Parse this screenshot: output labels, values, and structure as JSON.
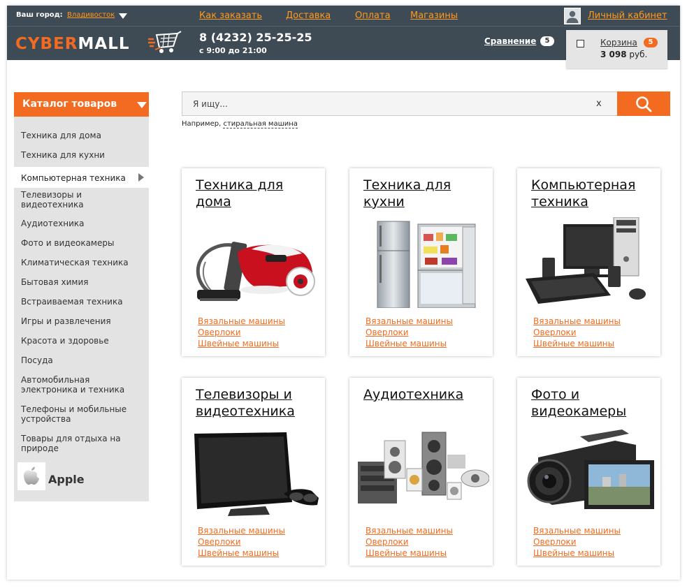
{
  "topbar": {
    "city_label": "Ваш город:",
    "city_value": "Владивосток",
    "nav": [
      "Как заказать",
      "Доставка",
      "Оплата",
      "Магазины"
    ],
    "account_link": "Личный кабинет"
  },
  "header": {
    "logo_part1": "CYBER",
    "logo_part2": "MALL",
    "phone": "8 (4232) 25-25-25",
    "hours": "с 9:00 до 21:00",
    "compare_label": "Сравнение",
    "compare_count": "5"
  },
  "cart": {
    "label": "Корзина",
    "count": "5",
    "sum": "3 098",
    "currency": "руб."
  },
  "catalog": {
    "title": "Каталог товаров",
    "items": [
      "Техника для дома",
      "Техника для кухни",
      "Компьютерная техника",
      "Телевизоры и видеотехника",
      "Аудиотехника",
      "Фото и видеокамеры",
      "Климатическая техника",
      "Бытовая химия",
      "Встраиваемая техника",
      "Игры и развлечения",
      "Красота и здоровье",
      "Посуда",
      "Автомобильная электроника и техника",
      "Телефоны и мобильные устройства",
      "Товары для отдыха на природе"
    ],
    "brand": "Apple"
  },
  "search": {
    "placeholder": "Я ищу...",
    "clear": "x",
    "hint_prefix": "Например,",
    "hint_example": "стиральная машина"
  },
  "cards": [
    {
      "title": "Техника для дома",
      "links": [
        "Вязальные машины",
        "Оверлоки",
        "Швейные машины"
      ]
    },
    {
      "title": "Техника для кухни",
      "links": [
        "Вязальные машины",
        "Оверлоки",
        "Швейные машины"
      ]
    },
    {
      "title": "Компьютерная техника",
      "links": [
        "Вязальные машины",
        "Оверлоки",
        "Швейные машины"
      ]
    },
    {
      "title": "Телевизоры и видеотехника",
      "links": [
        "Вязальные машины",
        "Оверлоки",
        "Швейные машины"
      ]
    },
    {
      "title": "Аудиотехника",
      "links": [
        "Вязальные машины",
        "Оверлоки",
        "Швейные машины"
      ]
    },
    {
      "title": "Фото и видеокамеры",
      "links": [
        "Вязальные машины",
        "Оверлоки",
        "Швейные машины"
      ]
    }
  ],
  "colors": {
    "accent": "#f26b21",
    "link_orange": "#ff9a1e",
    "header_bg": "#3e4a54",
    "sidebar_bg": "#e3e3e3"
  },
  "icons": [
    "user-icon",
    "search-icon",
    "apple-logo-icon",
    "cart-logo-icon"
  ]
}
